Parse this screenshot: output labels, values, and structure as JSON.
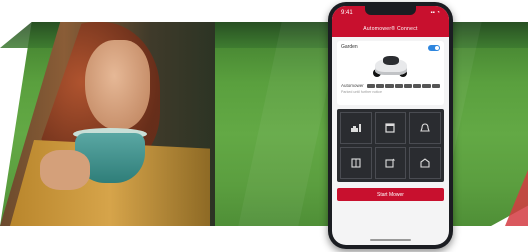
{
  "phone": {
    "status_time": "9:41",
    "status_icons": "▪▪ ◔",
    "app_title": "Automower® Connect",
    "card": {
      "label": "Garden",
      "mower_name": "Automower",
      "status_sub": "Parked until further notice",
      "toggle_on": true
    },
    "tiles": [
      {
        "icon": "mower-park-icon"
      },
      {
        "icon": "calendar-icon"
      },
      {
        "icon": "bell-icon"
      },
      {
        "icon": "map-icon"
      },
      {
        "icon": "settings-box-icon"
      },
      {
        "icon": "garage-icon"
      }
    ],
    "cta_label": "Start Mower"
  },
  "colors": {
    "brand_red": "#c8102e",
    "lawn_green": "#5aa03e"
  }
}
